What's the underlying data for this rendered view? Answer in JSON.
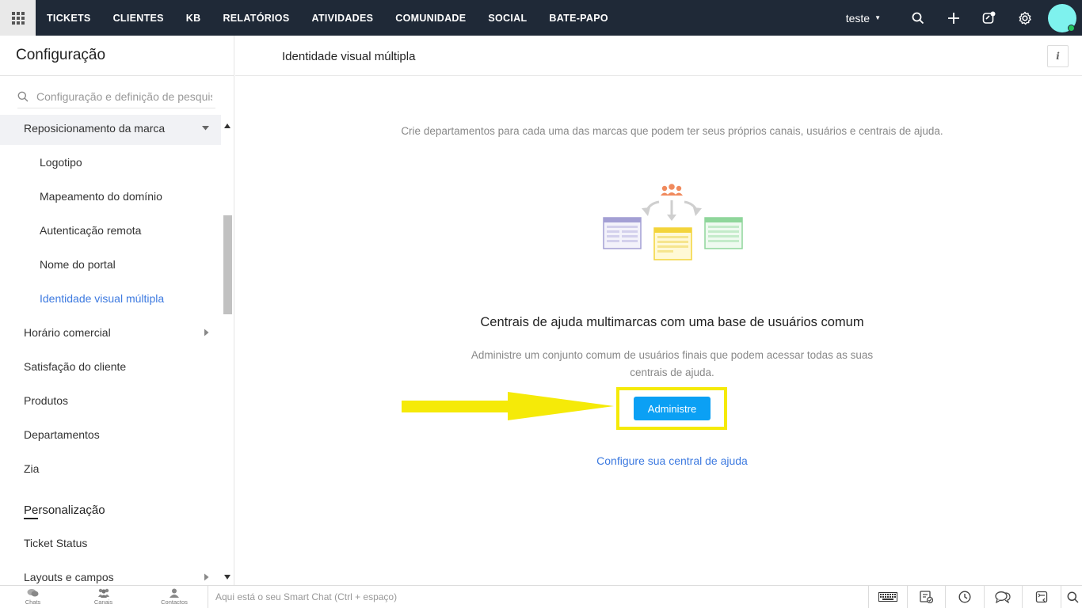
{
  "topnav": {
    "items": [
      "TICKETS",
      "CLIENTES",
      "KB",
      "RELATÓRIOS",
      "ATIVIDADES",
      "COMUNIDADE",
      "SOCIAL",
      "BATE-PAPO"
    ],
    "org_name": "teste"
  },
  "sidebar": {
    "title": "Configuração",
    "search_placeholder": "Configuração e definição de pesquisa",
    "items": [
      {
        "label": "Reposicionamento da marca",
        "level": "top",
        "state": "expanded"
      },
      {
        "label": "Logotipo",
        "level": "sub"
      },
      {
        "label": "Mapeamento do domínio",
        "level": "sub"
      },
      {
        "label": "Autenticação remota",
        "level": "sub"
      },
      {
        "label": "Nome do portal",
        "level": "sub"
      },
      {
        "label": "Identidade visual múltipla",
        "level": "sub",
        "state": "active"
      },
      {
        "label": "Horário comercial",
        "level": "top",
        "state": "collapsed"
      },
      {
        "label": "Satisfação do cliente",
        "level": "top"
      },
      {
        "label": "Produtos",
        "level": "top"
      },
      {
        "label": "Departamentos",
        "level": "top"
      },
      {
        "label": "Zia",
        "level": "top"
      }
    ],
    "section": "Personalização",
    "section_items": [
      {
        "label": "Ticket Status"
      },
      {
        "label": "Layouts e campos",
        "state": "collapsed"
      }
    ]
  },
  "main": {
    "title": "Identidade visual múltipla",
    "info_label": "i",
    "intro": "Crie departamentos para cada uma das marcas que podem ter seus próprios canais, usuários e centrais de ajuda.",
    "heading": "Centrais de ajuda multimarcas com uma base de usuários comum",
    "description": "Administre um conjunto comum de usuários finais que podem acessar todas as suas centrais de ajuda.",
    "button_label": "Administre",
    "link_label": "Configure sua central de ajuda"
  },
  "bottombar": {
    "tabs": [
      "Chats",
      "Canais",
      "Contactos"
    ],
    "smartchat_placeholder": "Aqui está o seu Smart Chat (Ctrl + espaço)"
  },
  "colors": {
    "topbar": "#1f2937",
    "accent": "#0ba0f4",
    "link": "#3d7ae0",
    "highlight": "#f5ea08",
    "avatar": "#7ef2ee"
  }
}
